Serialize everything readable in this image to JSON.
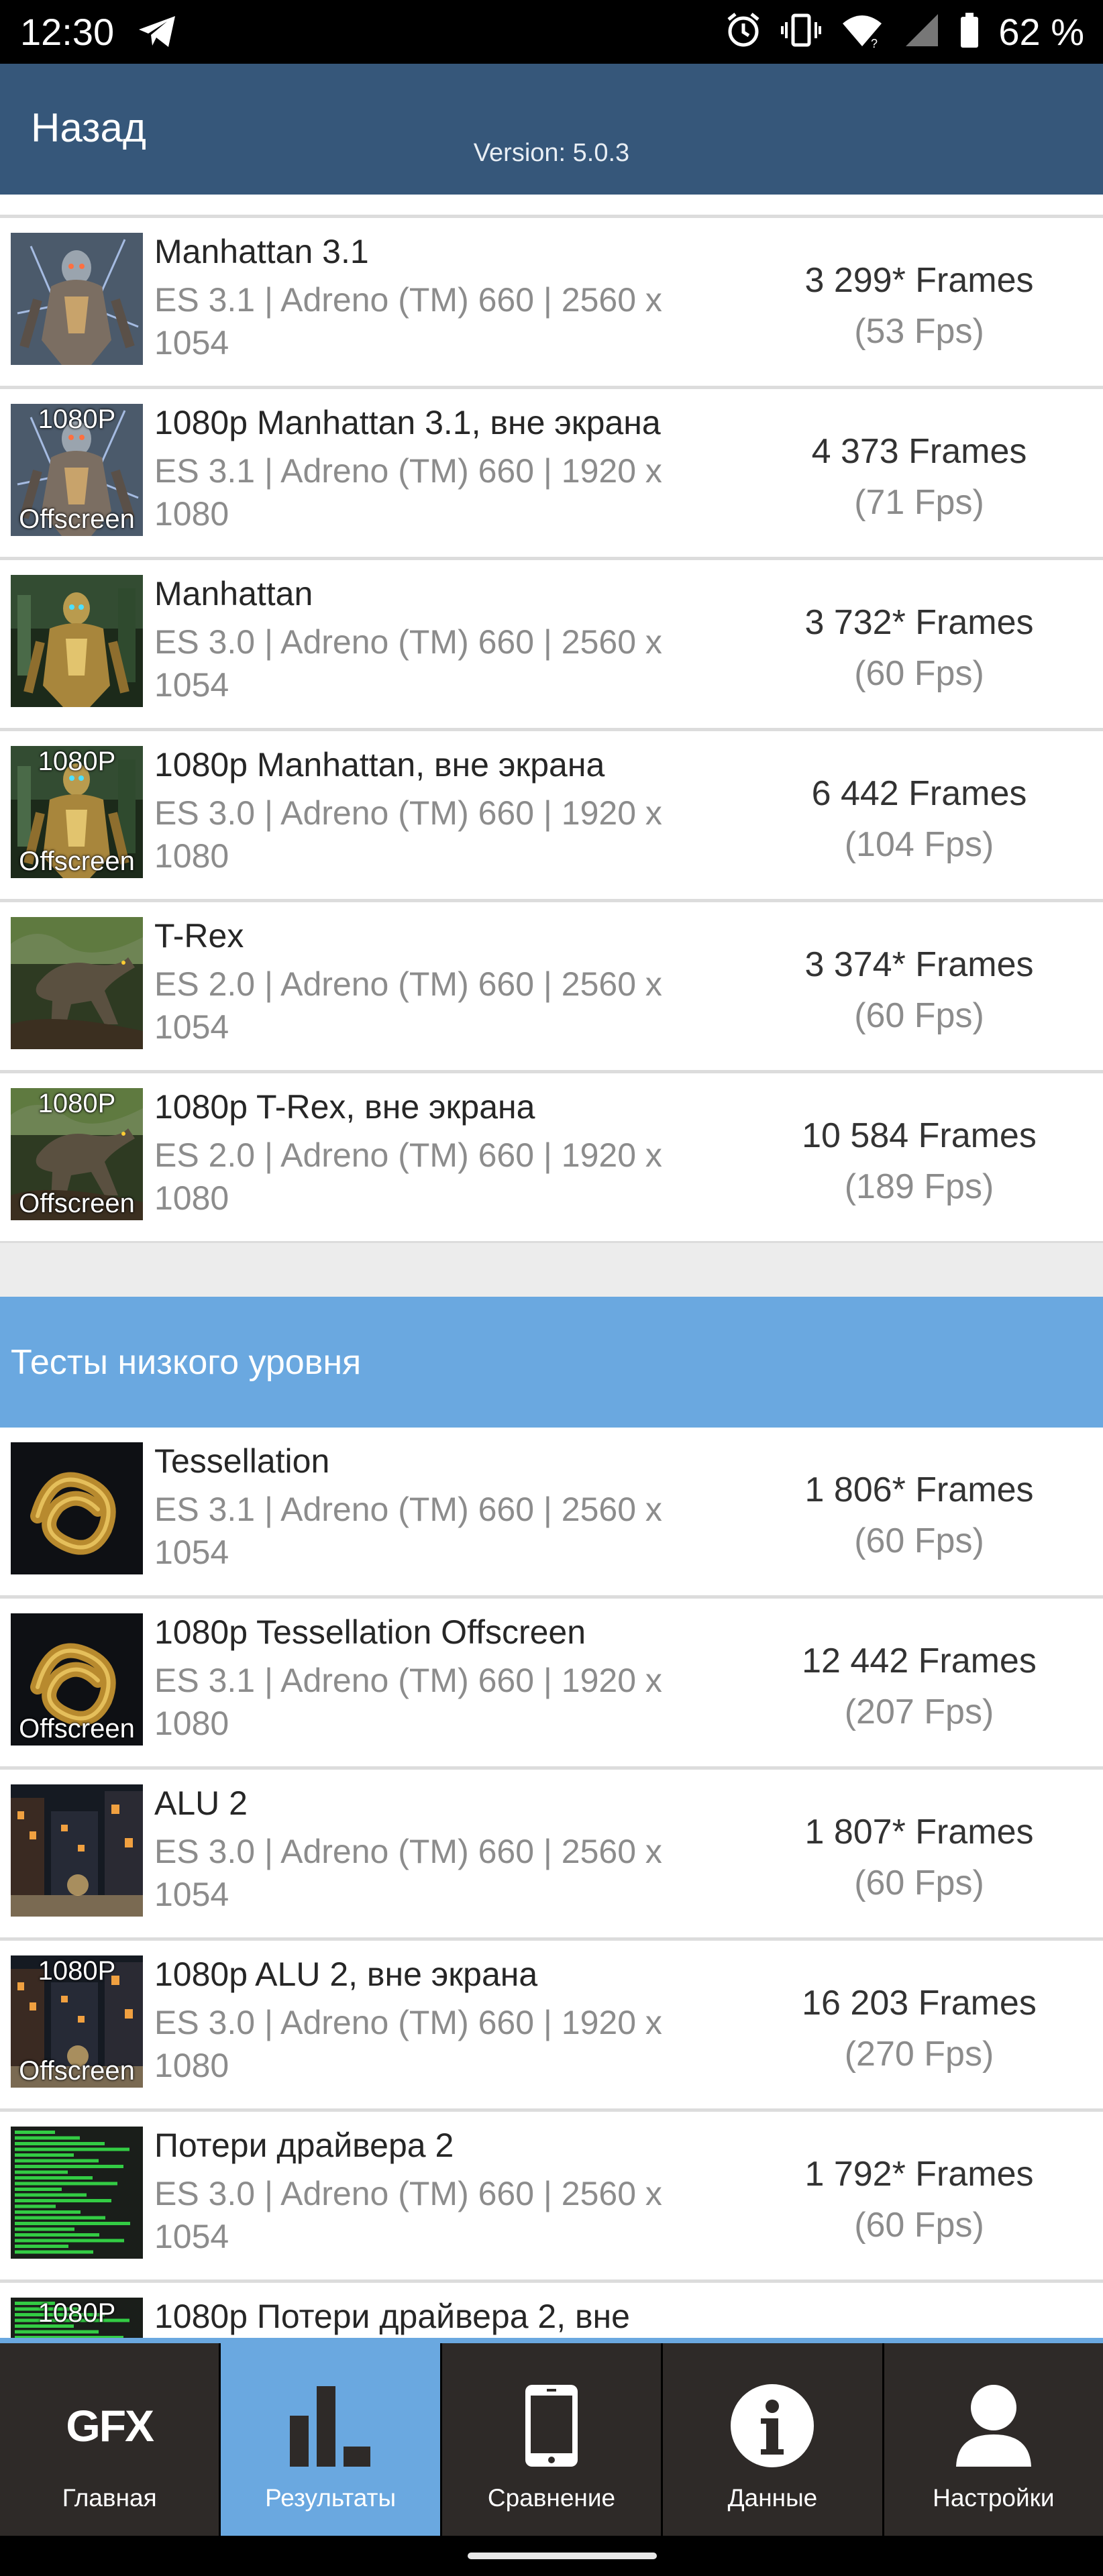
{
  "status_bar": {
    "time": "12:30",
    "battery_percent": "62 %",
    "icons": [
      "telegram-icon",
      "alarm-icon",
      "vibrate-icon",
      "wifi-icon",
      "signal-icon",
      "battery-icon"
    ]
  },
  "header": {
    "back_label": "Назад",
    "version": "Version: 5.0.3",
    "color": "#36577a"
  },
  "results_high": [
    {
      "title": "Manhattan 3.1",
      "sub": "ES 3.1 | Adreno (TM) 660 | 2560 x 1054",
      "score": "3 299* Frames",
      "fps": "(53 Fps)",
      "badge_top": "",
      "badge_bottom": "",
      "thumb": "robot-warrior"
    },
    {
      "title": "1080p Manhattan 3.1, вне экрана",
      "sub": "ES 3.1 | Adreno (TM) 660 | 1920 x 1080",
      "score": "4 373 Frames",
      "fps": "(71 Fps)",
      "badge_top": "1080P",
      "badge_bottom": "Offscreen",
      "thumb": "robot-warrior"
    },
    {
      "title": "Manhattan",
      "sub": "ES 3.0 | Adreno (TM) 660 | 2560 x 1054",
      "score": "3 732* Frames",
      "fps": "(60 Fps)",
      "badge_top": "",
      "badge_bottom": "",
      "thumb": "robot-gold"
    },
    {
      "title": "1080p Manhattan, вне экрана",
      "sub": "ES 3.0 | Adreno (TM) 660 | 1920 x 1080",
      "score": "6 442 Frames",
      "fps": "(104 Fps)",
      "badge_top": "1080P",
      "badge_bottom": "Offscreen",
      "thumb": "robot-gold"
    },
    {
      "title": "T-Rex",
      "sub": "ES 2.0 | Adreno (TM) 660 | 2560 x 1054",
      "score": "3 374* Frames",
      "fps": "(60 Fps)",
      "badge_top": "",
      "badge_bottom": "",
      "thumb": "trex"
    },
    {
      "title": "1080p T-Rex, вне экрана",
      "sub": "ES 2.0 | Adreno (TM) 660 | 1920 x 1080",
      "score": "10 584 Frames",
      "fps": "(189 Fps)",
      "badge_top": "1080P",
      "badge_bottom": "Offscreen",
      "thumb": "trex"
    }
  ],
  "section_low": {
    "title": "Тесты низкого уровня",
    "color": "#6aa8e0"
  },
  "results_low": [
    {
      "title": "Tessellation",
      "sub": "ES 3.1 | Adreno (TM) 660 | 2560 x 1054",
      "score": "1 806* Frames",
      "fps": "(60 Fps)",
      "badge_top": "",
      "badge_bottom": "",
      "thumb": "knot"
    },
    {
      "title": "1080p Tessellation Offscreen",
      "sub": "ES 3.1 | Adreno (TM) 660 | 1920 x 1080",
      "score": "12 442 Frames",
      "fps": "(207 Fps)",
      "badge_top": "",
      "badge_bottom": "Offscreen",
      "thumb": "knot"
    },
    {
      "title": "ALU 2",
      "sub": "ES 3.0 | Adreno (TM) 660 | 2560 x 1054",
      "score": "1 807* Frames",
      "fps": "(60 Fps)",
      "badge_top": "",
      "badge_bottom": "",
      "thumb": "city"
    },
    {
      "title": "1080p ALU 2, вне экрана",
      "sub": "ES 3.0 | Adreno (TM) 660 | 1920 x 1080",
      "score": "16 203 Frames",
      "fps": "(270 Fps)",
      "badge_top": "1080P",
      "badge_bottom": "Offscreen",
      "thumb": "city"
    },
    {
      "title": "Потери драйвера 2",
      "sub": "ES 3.0 | Adreno (TM) 660 | 2560 x 1054",
      "score": "1 792* Frames",
      "fps": "(60 Fps)",
      "badge_top": "",
      "badge_bottom": "",
      "thumb": "bars"
    },
    {
      "title": "1080p Потери драйвера 2, вне",
      "sub": "",
      "score": "",
      "fps": "",
      "badge_top": "1080P",
      "badge_bottom": "",
      "thumb": "bars"
    }
  ],
  "bottom_nav": {
    "items": [
      {
        "label": "Главная",
        "icon": "gfx-logo-icon",
        "text": "GFX",
        "active": false
      },
      {
        "label": "Результаты",
        "icon": "bar-chart-icon",
        "active": true
      },
      {
        "label": "Сравнение",
        "icon": "phone-icon",
        "active": false
      },
      {
        "label": "Данные",
        "icon": "info-icon",
        "active": false
      },
      {
        "label": "Настройки",
        "icon": "user-icon",
        "active": false
      }
    ],
    "accent": "#6aa8e0"
  }
}
